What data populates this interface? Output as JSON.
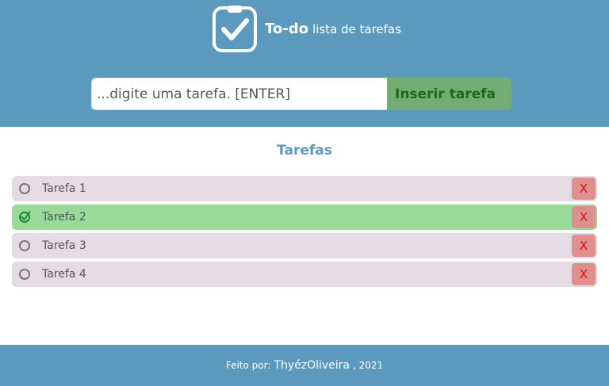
{
  "header": {
    "brand_bold": "To-do",
    "brand_rest": "lista de tarefas",
    "logo_icon": "clipboard-check-icon"
  },
  "search": {
    "placeholder": "...digite uma tarefa. [ENTER]",
    "button_label": "Inserir tarefa"
  },
  "section": {
    "title": "Tarefas"
  },
  "tasks": [
    {
      "label": "Tarefa 1",
      "done": false,
      "delete_label": "X"
    },
    {
      "label": "Tarefa 2",
      "done": true,
      "delete_label": "X"
    },
    {
      "label": "Tarefa 3",
      "done": false,
      "delete_label": "X"
    },
    {
      "label": "Tarefa 4",
      "done": false,
      "delete_label": "X"
    }
  ],
  "footer": {
    "prefix": "Feito por:",
    "author": "ThyézOliveira",
    "suffix": ", 2021"
  },
  "colors": {
    "header_bg": "#5b9abe",
    "task_bg": "#e5dce3",
    "task_done_bg": "#97da9a",
    "delete_bg": "#e08f8f",
    "button_bg": "#74ad74"
  }
}
